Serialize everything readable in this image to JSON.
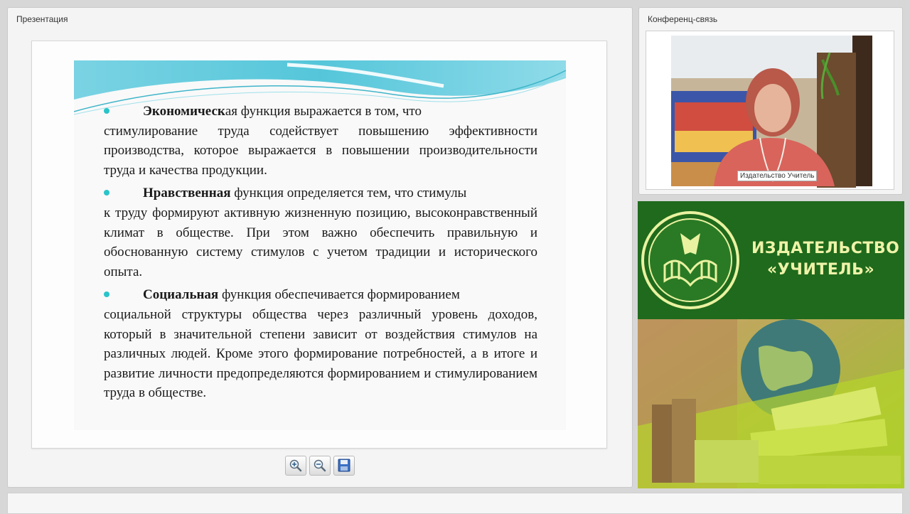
{
  "presentation": {
    "title": "Презентация",
    "paragraphs": [
      {
        "bold": "Экономическ",
        "first_line": "ая функция выражается в том, что",
        "rest": "стимулирование труда содействует повышению эффективности производства, которое выражается в повышении производительности труда и качества продукции."
      },
      {
        "bold": "Нравственная",
        "first_line": " функция определяется тем, что стимулы",
        "rest": "к труду формируют активную жизненную позицию, высоконравственный климат в обществе. При этом важно обеспечить правильную и обоснованную систему стимулов с учетом традиции и исторического опыта."
      },
      {
        "bold": "Социальная",
        "first_line": " функция обеспечивается формированием",
        "rest": "социальной структуры общества через различный уровень доходов, который в значительной степени зависит от воздействия стимулов на различных людей. Кроме этого формирование потребностей, а в итоге и развитие личности предопределяются формированием и стимулированием труда в обществе."
      }
    ],
    "toolbar": {
      "zoom_in_icon": "magnifier-plus-icon",
      "zoom_out_icon": "magnifier-minus-icon",
      "save_icon": "floppy-disk-icon"
    },
    "colors": {
      "bullet": "#29c4c9",
      "header_teal": "#4cc5d8"
    }
  },
  "conference": {
    "title": "Конференц-связь",
    "video_label": "Издательство Учитель"
  },
  "publisher": {
    "line1": "ИЗДАТЕЛЬСТВО",
    "line2": "«УЧИТЕЛЬ»",
    "colors": {
      "green": "#1f6a1c",
      "text": "#eef3a8"
    }
  }
}
